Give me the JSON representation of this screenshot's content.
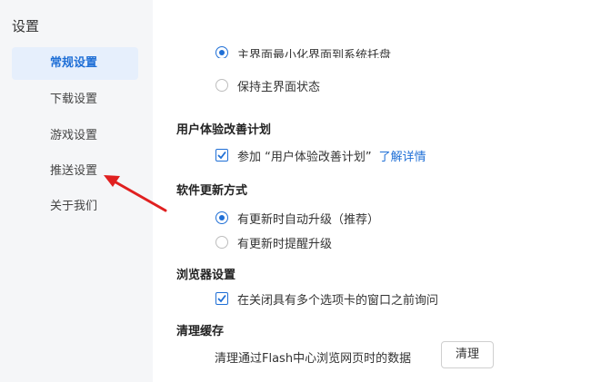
{
  "sidebar": {
    "title": "设置",
    "items": [
      {
        "label": "常规设置",
        "active": true
      },
      {
        "label": "下载设置",
        "active": false
      },
      {
        "label": "游戏设置",
        "active": false
      },
      {
        "label": "推送设置",
        "active": false
      },
      {
        "label": "关于我们",
        "active": false
      }
    ]
  },
  "tray": {
    "option_minimize": "主界面最小化界面到系统托盘",
    "option_keep": "保持主界面状态",
    "selected": "option_minimize"
  },
  "ux_plan": {
    "heading": "用户体验改善计划",
    "join_label": "参加 “用户体验改善计划”",
    "join_checked": true,
    "learn_more": "了解详情"
  },
  "update": {
    "heading": "软件更新方式",
    "auto_label": "有更新时自动升级（推荐）",
    "remind_label": "有更新时提醒升级",
    "selected": "auto"
  },
  "browser": {
    "heading": "浏览器设置",
    "confirm_close_label": "在关闭具有多个选项卡的窗口之前询问",
    "confirm_close_checked": true
  },
  "cache": {
    "heading": "清理缓存",
    "description": "清理通过Flash中心浏览网页时的数据",
    "button_label": "清理"
  },
  "colors": {
    "accent": "#1f6fd6",
    "sidebar_bg": "#f5f6f8",
    "active_bg": "#e6effc",
    "arrow": "#e02020"
  }
}
